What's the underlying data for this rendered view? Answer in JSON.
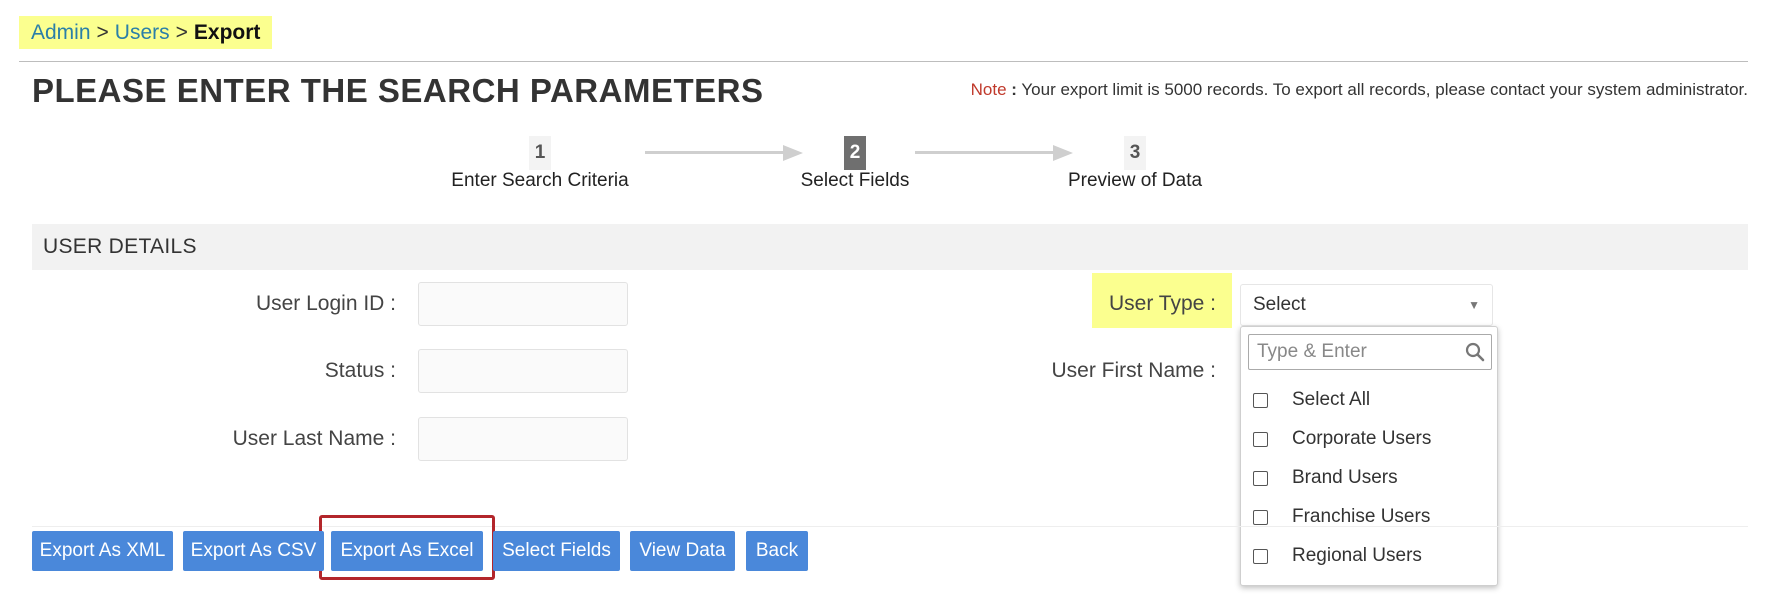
{
  "breadcrumb": {
    "items": [
      "Admin",
      "Users"
    ],
    "separator": ">",
    "current": "Export"
  },
  "page": {
    "title": "PLEASE ENTER THE SEARCH PARAMETERS",
    "note_label": "Note",
    "note_colon": " :",
    "note_text": " Your export limit is 5000 records. To export all records, please contact your system administrator."
  },
  "steps": [
    {
      "number": "1",
      "label": "Enter Search Criteria",
      "active": false
    },
    {
      "number": "2",
      "label": "Select Fields",
      "active": true
    },
    {
      "number": "3",
      "label": "Preview of Data",
      "active": false
    }
  ],
  "section": {
    "title": "USER DETAILS"
  },
  "fields": {
    "user_login_id": {
      "label": "User Login ID :",
      "value": ""
    },
    "status": {
      "label": "Status :",
      "value": ""
    },
    "user_last_name": {
      "label": "User Last Name :",
      "value": ""
    },
    "user_type": {
      "label": "User Type :",
      "selected": "Select"
    },
    "user_first_name": {
      "label": "User First Name :"
    }
  },
  "dropdown": {
    "search_placeholder": "Type & Enter",
    "options": [
      "Select All",
      "Corporate Users",
      "Brand Users",
      "Franchise Users",
      "Regional Users"
    ]
  },
  "buttons": {
    "export_xml": "Export As XML",
    "export_csv": "Export As CSV",
    "export_excel": "Export As Excel",
    "select_fields": "Select Fields",
    "view_data": "View Data",
    "back": "Back"
  },
  "colors": {
    "highlight": "#fbff8f",
    "button": "#4a88da",
    "link": "#2a7fa8",
    "focus_frame": "#b3262b",
    "note_label": "#c0392b"
  },
  "icons": {
    "search": "search-icon",
    "caret": "chevron-down-icon"
  }
}
